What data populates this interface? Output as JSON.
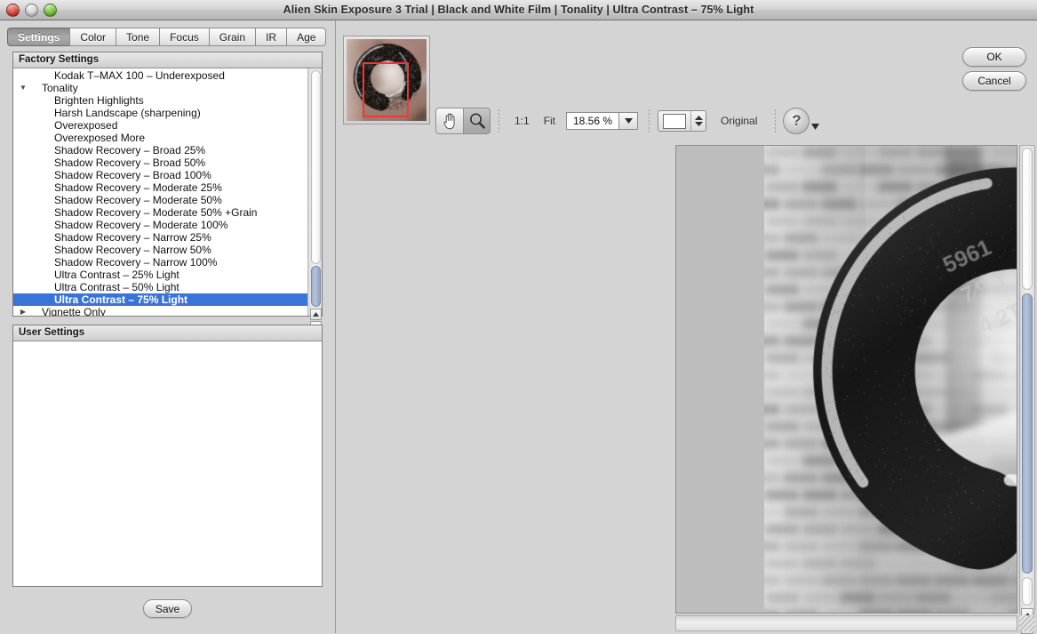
{
  "window": {
    "title": "Alien Skin Exposure 3 Trial | Black and White Film | Tonality | Ultra Contrast – 75% Light",
    "traffic_lights": [
      "close-button",
      "minimize-button",
      "zoom-button"
    ]
  },
  "tabs": [
    {
      "label": "Settings",
      "active": true
    },
    {
      "label": "Color",
      "active": false
    },
    {
      "label": "Tone",
      "active": false
    },
    {
      "label": "Focus",
      "active": false
    },
    {
      "label": "Grain",
      "active": false
    },
    {
      "label": "IR",
      "active": false
    },
    {
      "label": "Age",
      "active": false
    }
  ],
  "factory_settings": {
    "header": "Factory Settings",
    "items": [
      {
        "label": "Kodak T–MAX 100 – Underexposed",
        "level": 1,
        "disclosure": "",
        "selected": false
      },
      {
        "label": "Tonality",
        "level": 0,
        "disclosure": "▼",
        "selected": false
      },
      {
        "label": "Brighten Highlights",
        "level": 1,
        "disclosure": "",
        "selected": false
      },
      {
        "label": "Harsh Landscape (sharpening)",
        "level": 1,
        "disclosure": "",
        "selected": false
      },
      {
        "label": "Overexposed",
        "level": 1,
        "disclosure": "",
        "selected": false
      },
      {
        "label": "Overexposed More",
        "level": 1,
        "disclosure": "",
        "selected": false
      },
      {
        "label": "Shadow Recovery – Broad  25%",
        "level": 1,
        "disclosure": "",
        "selected": false
      },
      {
        "label": "Shadow Recovery – Broad  50%",
        "level": 1,
        "disclosure": "",
        "selected": false
      },
      {
        "label": "Shadow Recovery – Broad 100%",
        "level": 1,
        "disclosure": "",
        "selected": false
      },
      {
        "label": "Shadow Recovery – Moderate  25%",
        "level": 1,
        "disclosure": "",
        "selected": false
      },
      {
        "label": "Shadow Recovery – Moderate  50%",
        "level": 1,
        "disclosure": "",
        "selected": false
      },
      {
        "label": "Shadow Recovery – Moderate  50% +Grain",
        "level": 1,
        "disclosure": "",
        "selected": false
      },
      {
        "label": "Shadow Recovery – Moderate 100%",
        "level": 1,
        "disclosure": "",
        "selected": false
      },
      {
        "label": "Shadow Recovery – Narrow  25%",
        "level": 1,
        "disclosure": "",
        "selected": false
      },
      {
        "label": "Shadow Recovery – Narrow  50%",
        "level": 1,
        "disclosure": "",
        "selected": false
      },
      {
        "label": "Shadow Recovery – Narrow 100%",
        "level": 1,
        "disclosure": "",
        "selected": false
      },
      {
        "label": "Ultra Contrast – 25% Light",
        "level": 1,
        "disclosure": "",
        "selected": false
      },
      {
        "label": "Ultra Contrast – 50% Light",
        "level": 1,
        "disclosure": "",
        "selected": false
      },
      {
        "label": "Ultra Contrast – 75% Light",
        "level": 1,
        "disclosure": "",
        "selected": true
      },
      {
        "label": "Vignette Only",
        "level": 0,
        "disclosure": "▶",
        "selected": false
      }
    ],
    "selection_color": "#3a74d8"
  },
  "user_settings": {
    "header": "User Settings",
    "items": [],
    "save_label": "Save"
  },
  "toolbar": {
    "hand_tool": "hand-tool",
    "zoom_tool": "zoom-tool",
    "one_to_one_label": "1:1",
    "fit_label": "Fit",
    "zoom_value": "18.56 %",
    "zoom_dropdown_icon": "chevron-down-icon",
    "background_swatch_color": "#ffffff",
    "stepper_icon": "stepper-up-down-icon",
    "original_label": "Original",
    "help_label": "?",
    "help_dropdown_icon": "chevron-down-icon"
  },
  "dialog_buttons": {
    "ok_label": "OK",
    "cancel_label": "Cancel"
  },
  "navigator": {
    "name": "navigator-thumbnail",
    "crop_rect_color": "#ef3a33"
  },
  "preview": {
    "image_description": "black-and-white-photo-of-metal-hook",
    "matte_color": "#bdbdbd"
  },
  "scrollbars": {
    "list_thumb_color": "#9fb0cc",
    "preview_thumb_color": "#8ea3c4"
  }
}
